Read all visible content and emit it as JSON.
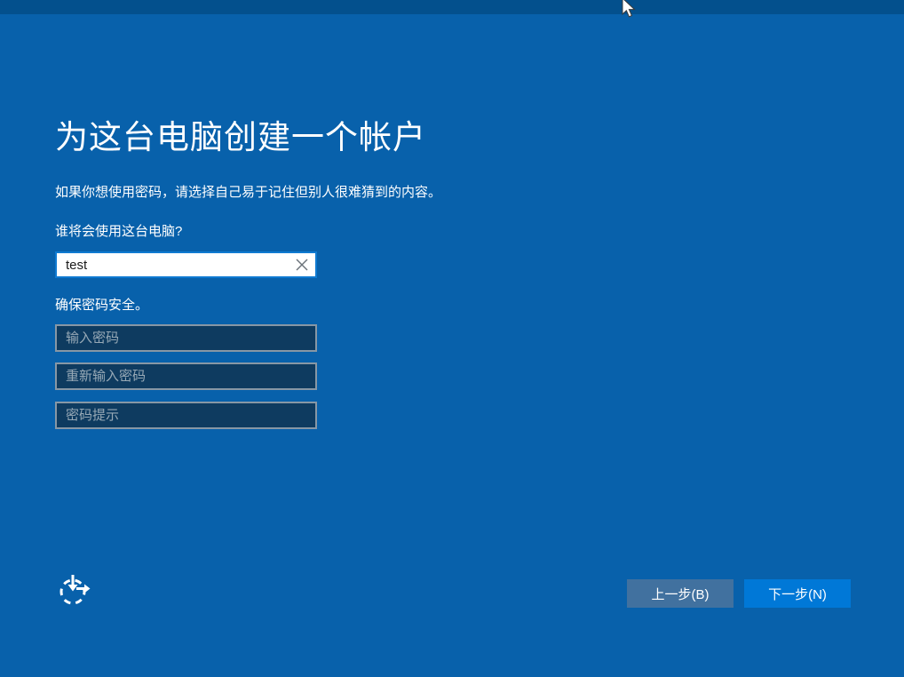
{
  "page": {
    "title": "为这台电脑创建一个帐户",
    "subtitle": "如果你想使用密码，请选择自己易于记住但别人很难猜到的内容。"
  },
  "form": {
    "username_label": "谁将会使用这台电脑?",
    "username_value": "test",
    "security_label": "确保密码安全。",
    "password_placeholder": "输入密码",
    "confirm_placeholder": "重新输入密码",
    "hint_placeholder": "密码提示"
  },
  "footer": {
    "back_label": "上一步(B)",
    "next_label": "下一步(N)"
  },
  "icons": {
    "clear_icon": "clear-x",
    "ease_of_access_icon": "ease-of-access",
    "mouse_cursor": "arrow-pointer"
  },
  "colors": {
    "background": "#0861ab",
    "top_strip": "#03508d",
    "focused_input_border": "#0f7ad1",
    "password_field_fill": "#0e3b60",
    "password_field_border": "#8797a5",
    "placeholder_text": "#97a9b6",
    "back_button": "#41719f",
    "next_button": "#0078d7",
    "text": "#ffffff"
  }
}
